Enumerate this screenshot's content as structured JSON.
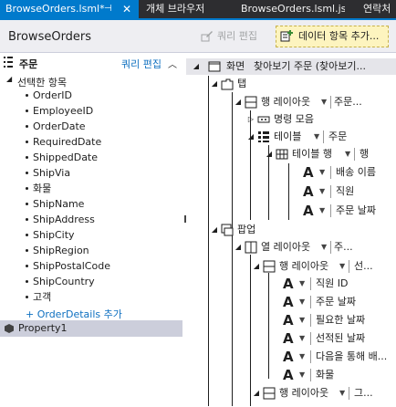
{
  "tabs": {
    "active_label": "BrowseOrders.lsml*",
    "pin_glyph": "⊣",
    "close_glyph": "✕",
    "tab2": "개체 브라우저",
    "tab3": "BrowseOrders.lsml.js",
    "tab4": "연락처"
  },
  "header": {
    "title": "BrowseOrders",
    "edit_query": "쿼리 편집",
    "add_data_item": "데이터 항목 추가..."
  },
  "left": {
    "title": "주문",
    "edit_query_link": "쿼리 편집",
    "selected_label": "선택한 항목",
    "fields": [
      "OrderID",
      "EmployeeID",
      "OrderDate",
      "RequiredDate",
      "ShippedDate",
      "ShipVia",
      "화물",
      "ShipName",
      "ShipAddress",
      "ShipCity",
      "ShipRegion",
      "ShipPostalCode",
      "ShipCountry",
      "고객"
    ],
    "add_details": "+ OrderDetails 추가",
    "property": "Property1"
  },
  "tree": {
    "screen_label": "화면",
    "screen_caption": "찾아보기 주문 (찾아보기...",
    "tabs_label": "탭",
    "rows_layout": "행 레이아웃",
    "rows_caption": "주문...",
    "command_bar": "명령 모음",
    "table": "테이블",
    "table_caption": "주문",
    "table_row": "테이블 행",
    "table_row_caption": "행",
    "ship_name": "배송 이름",
    "employee": "직원",
    "order_date": "주문 날짜",
    "popups": "팝업",
    "columns_layout": "열 레이아웃",
    "columns_caption": "주...",
    "rows_layout2": "행 레이아웃",
    "rows2_caption": "선...",
    "employee_id": "직원 ID",
    "order_date2": "주문 날짜",
    "required_date": "필요한 날짜",
    "shipped_date": "선적된 날짜",
    "ship_via": "다음을 통해 배...",
    "freight": "화물",
    "rows_layout3": "행 레이아웃",
    "rows3_caption": "그..."
  },
  "colors": {
    "accent": "#007acc",
    "tab_bg": "#2d2d30",
    "link": "#0e70c0",
    "selection": "#cccedb",
    "add_button_bg": "#fdf4bf"
  }
}
